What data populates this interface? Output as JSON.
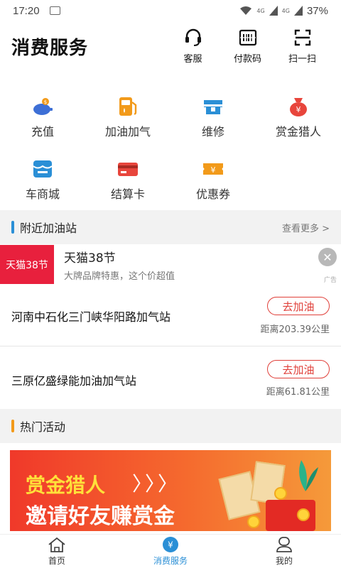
{
  "status_bar": {
    "time": "17:20",
    "net1": "4G",
    "net2": "4G",
    "battery": "37%"
  },
  "header": {
    "title": "消费服务",
    "actions": [
      {
        "label": "客服",
        "icon": "headset-icon"
      },
      {
        "label": "付款码",
        "icon": "barcode-icon"
      },
      {
        "label": "扫一扫",
        "icon": "scan-icon"
      }
    ]
  },
  "services": [
    {
      "label": "充值",
      "icon": "piggy-bank-icon",
      "color": "#3d6fd6"
    },
    {
      "label": "加油加气",
      "icon": "fuel-pump-icon",
      "color": "#f29a1a"
    },
    {
      "label": "维修",
      "icon": "car-repair-icon",
      "color": "#2a8fd6"
    },
    {
      "label": "赏金猎人",
      "icon": "money-bag-icon",
      "color": "#e8453c"
    },
    {
      "label": "车商城",
      "icon": "shop-icon",
      "color": "#2a8fd6"
    },
    {
      "label": "结算卡",
      "icon": "card-icon",
      "color": "#e8453c"
    },
    {
      "label": "优惠券",
      "icon": "coupon-icon",
      "color": "#f29a1a"
    }
  ],
  "nearby": {
    "title": "附近加油站",
    "more": "查看更多 >",
    "accent": "#2a8fd6"
  },
  "ad": {
    "logo_text": "天猫38节",
    "title": "天猫38节",
    "subtitle": "大牌品牌特惠，这个价超值",
    "tag": "广告",
    "close": "✕"
  },
  "stations": [
    {
      "name": "河南中石化三门峡华阳路加气站",
      "button": "去加油",
      "distance": "距离203.39公里"
    },
    {
      "name": "三原亿盛绿能加油加气站",
      "button": "去加油",
      "distance": "距离61.81公里"
    }
  ],
  "hot": {
    "title": "热门活动",
    "accent": "#f29a1a"
  },
  "banner": {
    "line1": "赏金猎人",
    "arrows": "〉〉〉",
    "line2": "邀请好友赚赏金"
  },
  "tabs": [
    {
      "label": "首页",
      "icon": "home-icon"
    },
    {
      "label": "消费服务",
      "icon": "yuan-icon"
    },
    {
      "label": "我的",
      "icon": "profile-icon"
    }
  ]
}
